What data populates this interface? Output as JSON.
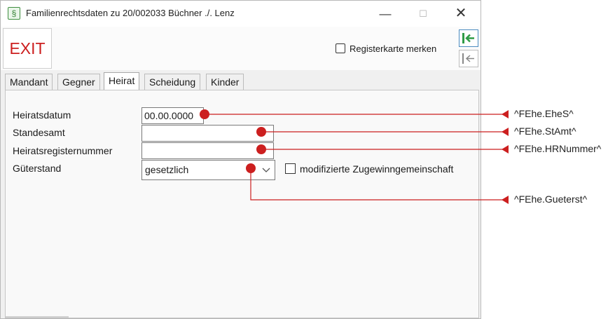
{
  "window": {
    "title": "Familienrechtsdaten zu 20/002033 Büchner ./. Lenz",
    "app_icon": "§",
    "minimize": "—",
    "maximize": "☐",
    "close": "✕"
  },
  "toolbar": {
    "exit_label": "EXIT",
    "register_label": "Registerkarte merken",
    "register_checked": false
  },
  "tabs": [
    {
      "label": "Mandant",
      "active": false
    },
    {
      "label": "Gegner",
      "active": false
    },
    {
      "label": "Heirat",
      "active": true
    },
    {
      "label": "Scheidung",
      "active": false
    },
    {
      "label": "Kinder",
      "active": false
    }
  ],
  "form": {
    "heiratsdatum": {
      "label": "Heiratsdatum",
      "value": "00.00.0000"
    },
    "standesamt": {
      "label": "Standesamt",
      "value": ""
    },
    "hrnummer": {
      "label": "Heiratsregisternummer",
      "value": ""
    },
    "gueterstand": {
      "label": "Güterstand",
      "value": "gesetzlich"
    },
    "modifizierte": {
      "label": "modifizierte Zugewinngemeinschaft",
      "checked": false
    }
  },
  "annotations": [
    {
      "label": "^FEhe.EheS^"
    },
    {
      "label": "^FEhe.StAmt^"
    },
    {
      "label": "^FEhe.HRNummer^"
    },
    {
      "label": "^FEhe.Gueterst^"
    }
  ],
  "colors": {
    "annotation": "#cc1f1f",
    "exit_text": "#cc1f1f",
    "nav_green": "#2f9b46"
  }
}
